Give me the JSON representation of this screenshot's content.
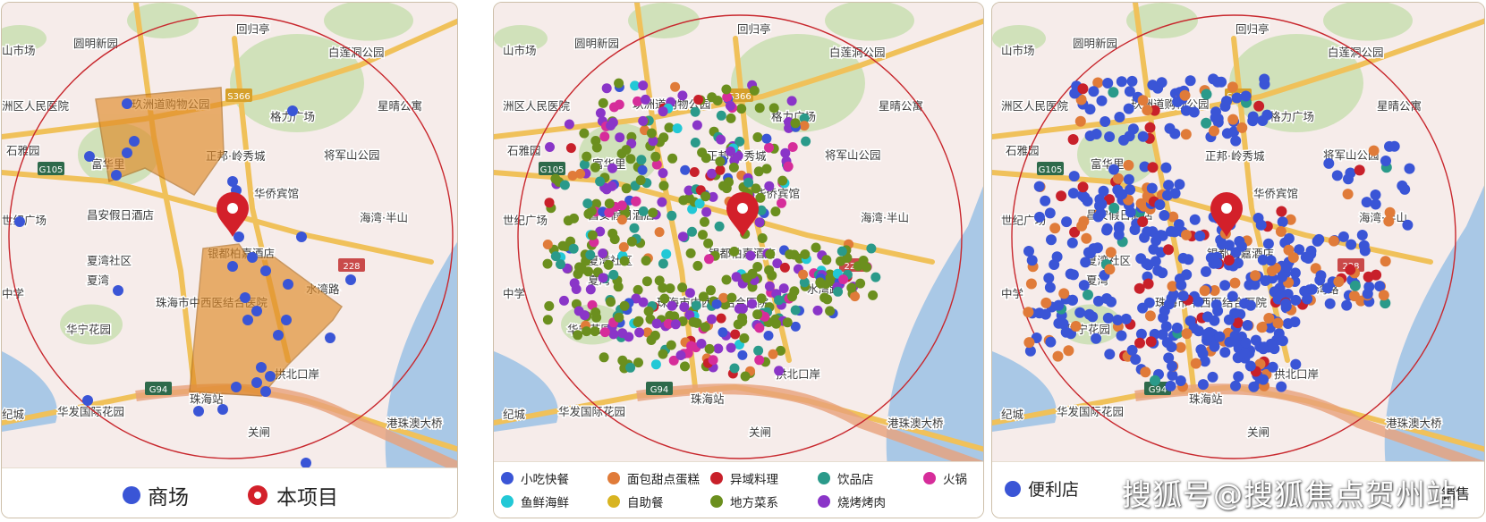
{
  "map_labels": {
    "mall_market": "山市场",
    "yuanming": "圆明新园",
    "huiguiting": "回归亭",
    "bailian": "白莲洞公园",
    "hospital": "洲区人民医院",
    "jiuzhou": "玖洲道购物公园",
    "road_s366": "S366",
    "gelifang": "格力广场",
    "xingqing": "星晴公寓",
    "zhengbang": "正邦·岭秀城",
    "jiangjun": "将军山公园",
    "shiyayuan": "石雅园",
    "fuhuali": "富华里",
    "road_g105": "G105",
    "huaqiao": "华侨宾馆",
    "shiji": "世纪广场",
    "changan": "昌安假日酒店",
    "haiwan": "海湾·半山",
    "yindu": "银都柏嘉酒店",
    "xiawan_community": "夏湾社区",
    "xiawan": "夏湾",
    "road_228": "228",
    "shuiwanlu": "水湾路",
    "middle_school": "中学",
    "zhongxiyi": "珠海市中西医结合医院",
    "huaning": "华宁花园",
    "road_g94": "G94",
    "gongbei": "拱北口岸",
    "zhuhai_station": "珠海站",
    "shijicheng": "纪城",
    "huafa": "华发国际花园",
    "guanzha": "关闸",
    "gangzhu": "港珠澳大桥"
  },
  "legends": {
    "panel1": {
      "mall": "商场",
      "project": "本项目"
    },
    "panel2": {
      "snack": "小吃快餐",
      "bakery": "面包甜点蛋糕",
      "foreign": "异域料理",
      "drinks": "饮品店",
      "hotpot": "火锅",
      "seafood": "鱼鲜海鲜",
      "buffet": "自助餐",
      "local": "地方菜系",
      "bbq": "烧烤烤肉"
    },
    "panel3": {
      "convenience": "便利店",
      "retail_suffix": "销售"
    }
  },
  "colors": {
    "mall": "#3a55d6",
    "project": "#d3202a",
    "snack": "#3a55d6",
    "bakery": "#e07b39",
    "foreign": "#c8202a",
    "drinks": "#2a9a8a",
    "hotpot": "#d62d9a",
    "seafood": "#22c8d6",
    "buffet": "#d8b421",
    "local": "#6b8f1e",
    "bbq": "#8a35c8",
    "convenience": "#3a55d6"
  },
  "watermark": "搜狐号@搜狐焦点贺州站"
}
